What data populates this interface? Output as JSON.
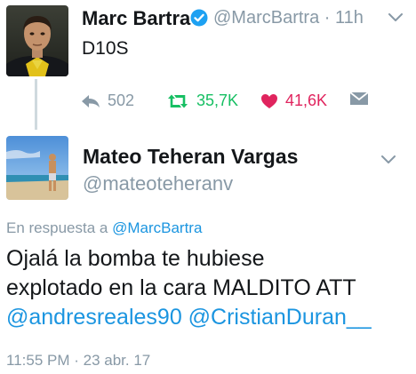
{
  "tweet1": {
    "author_name": "Marc Bartra",
    "handle": "@MarcBartra",
    "time": "11h",
    "separator": "·",
    "text": "D10S",
    "actions": {
      "reply_count": "502",
      "retweet_count": "35,7K",
      "like_count": "41,6K"
    },
    "icons": [
      "verified-badge-icon",
      "chevron-down-icon",
      "reply-icon",
      "retweet-icon",
      "heart-icon",
      "direct-message-icon"
    ]
  },
  "tweet2": {
    "author_name": "Mateo Teheran Vargas",
    "handle": "@mateoteheranv",
    "reply_prefix": "En respuesta a",
    "reply_to": "@MarcBartra",
    "text_line1": "Ojalá la bomba te hubiese",
    "text_line2": "explotado en la cara MALDITO ATT",
    "mention1": "@andresreales90",
    "mention2": "@CristianDuran__",
    "timestamp": "11:55 PM · 23 abr. 17"
  },
  "colors": {
    "link": "#1b95e0",
    "muted": "#8899a6",
    "retweet": "#17bf63",
    "like": "#e0245e",
    "verified": "#1da1f2"
  }
}
